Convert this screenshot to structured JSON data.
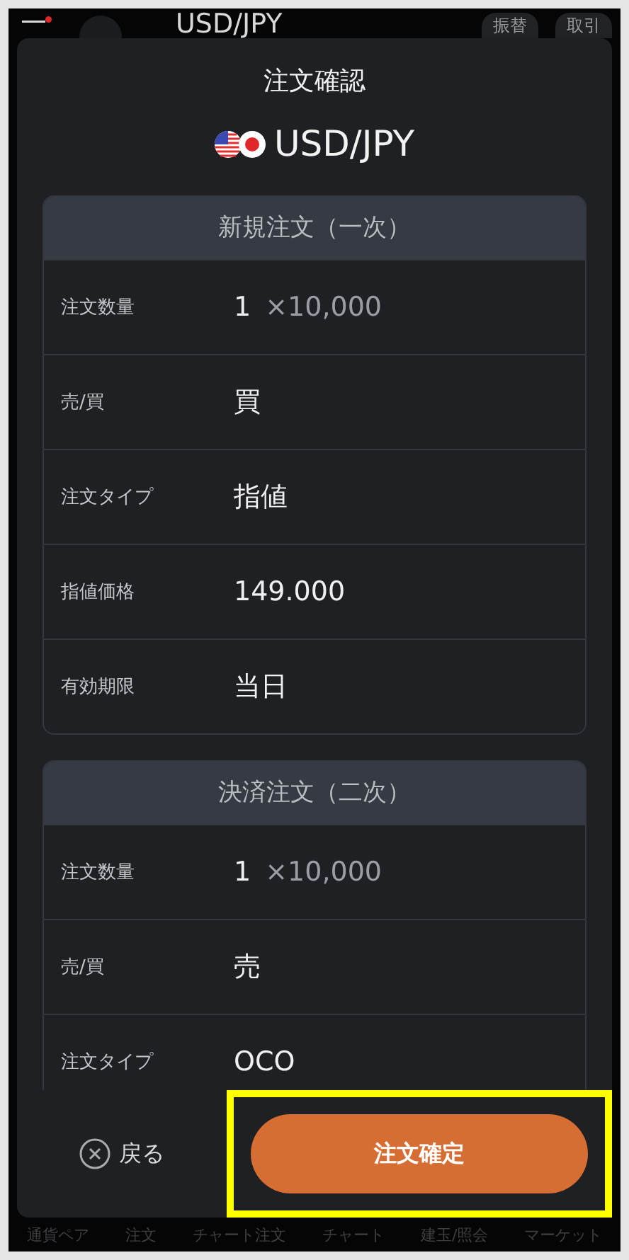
{
  "background_app": {
    "title": "USD/JPY",
    "buttons": [
      "振替",
      "取引"
    ],
    "nav": [
      {
        "label": "通貨ペア"
      },
      {
        "label": "注文"
      },
      {
        "label": "チャート注文"
      },
      {
        "label": "チャート"
      },
      {
        "label": "建玉/照会"
      },
      {
        "label": "マーケット"
      }
    ]
  },
  "dialog": {
    "title": "注文確認",
    "pair": "USD/JPY",
    "sections": [
      {
        "title": "新規注文（一次）",
        "rows": [
          {
            "label": "注文数量",
            "value": "1",
            "unit": "×10,000"
          },
          {
            "label": "売/買",
            "value": "買"
          },
          {
            "label": "注文タイプ",
            "value": "指値"
          },
          {
            "label": "指値価格",
            "value": "149.000"
          },
          {
            "label": "有効期限",
            "value": "当日"
          }
        ]
      },
      {
        "title": "決済注文（二次）",
        "rows": [
          {
            "label": "注文数量",
            "value": "1",
            "unit": "×10,000"
          },
          {
            "label": "売/買",
            "value": "売"
          },
          {
            "label": "注文タイプ",
            "value": "OCO"
          }
        ]
      }
    ],
    "cancel": "戻る",
    "confirm": {
      "label": "注文確定",
      "highlighted": true
    }
  }
}
